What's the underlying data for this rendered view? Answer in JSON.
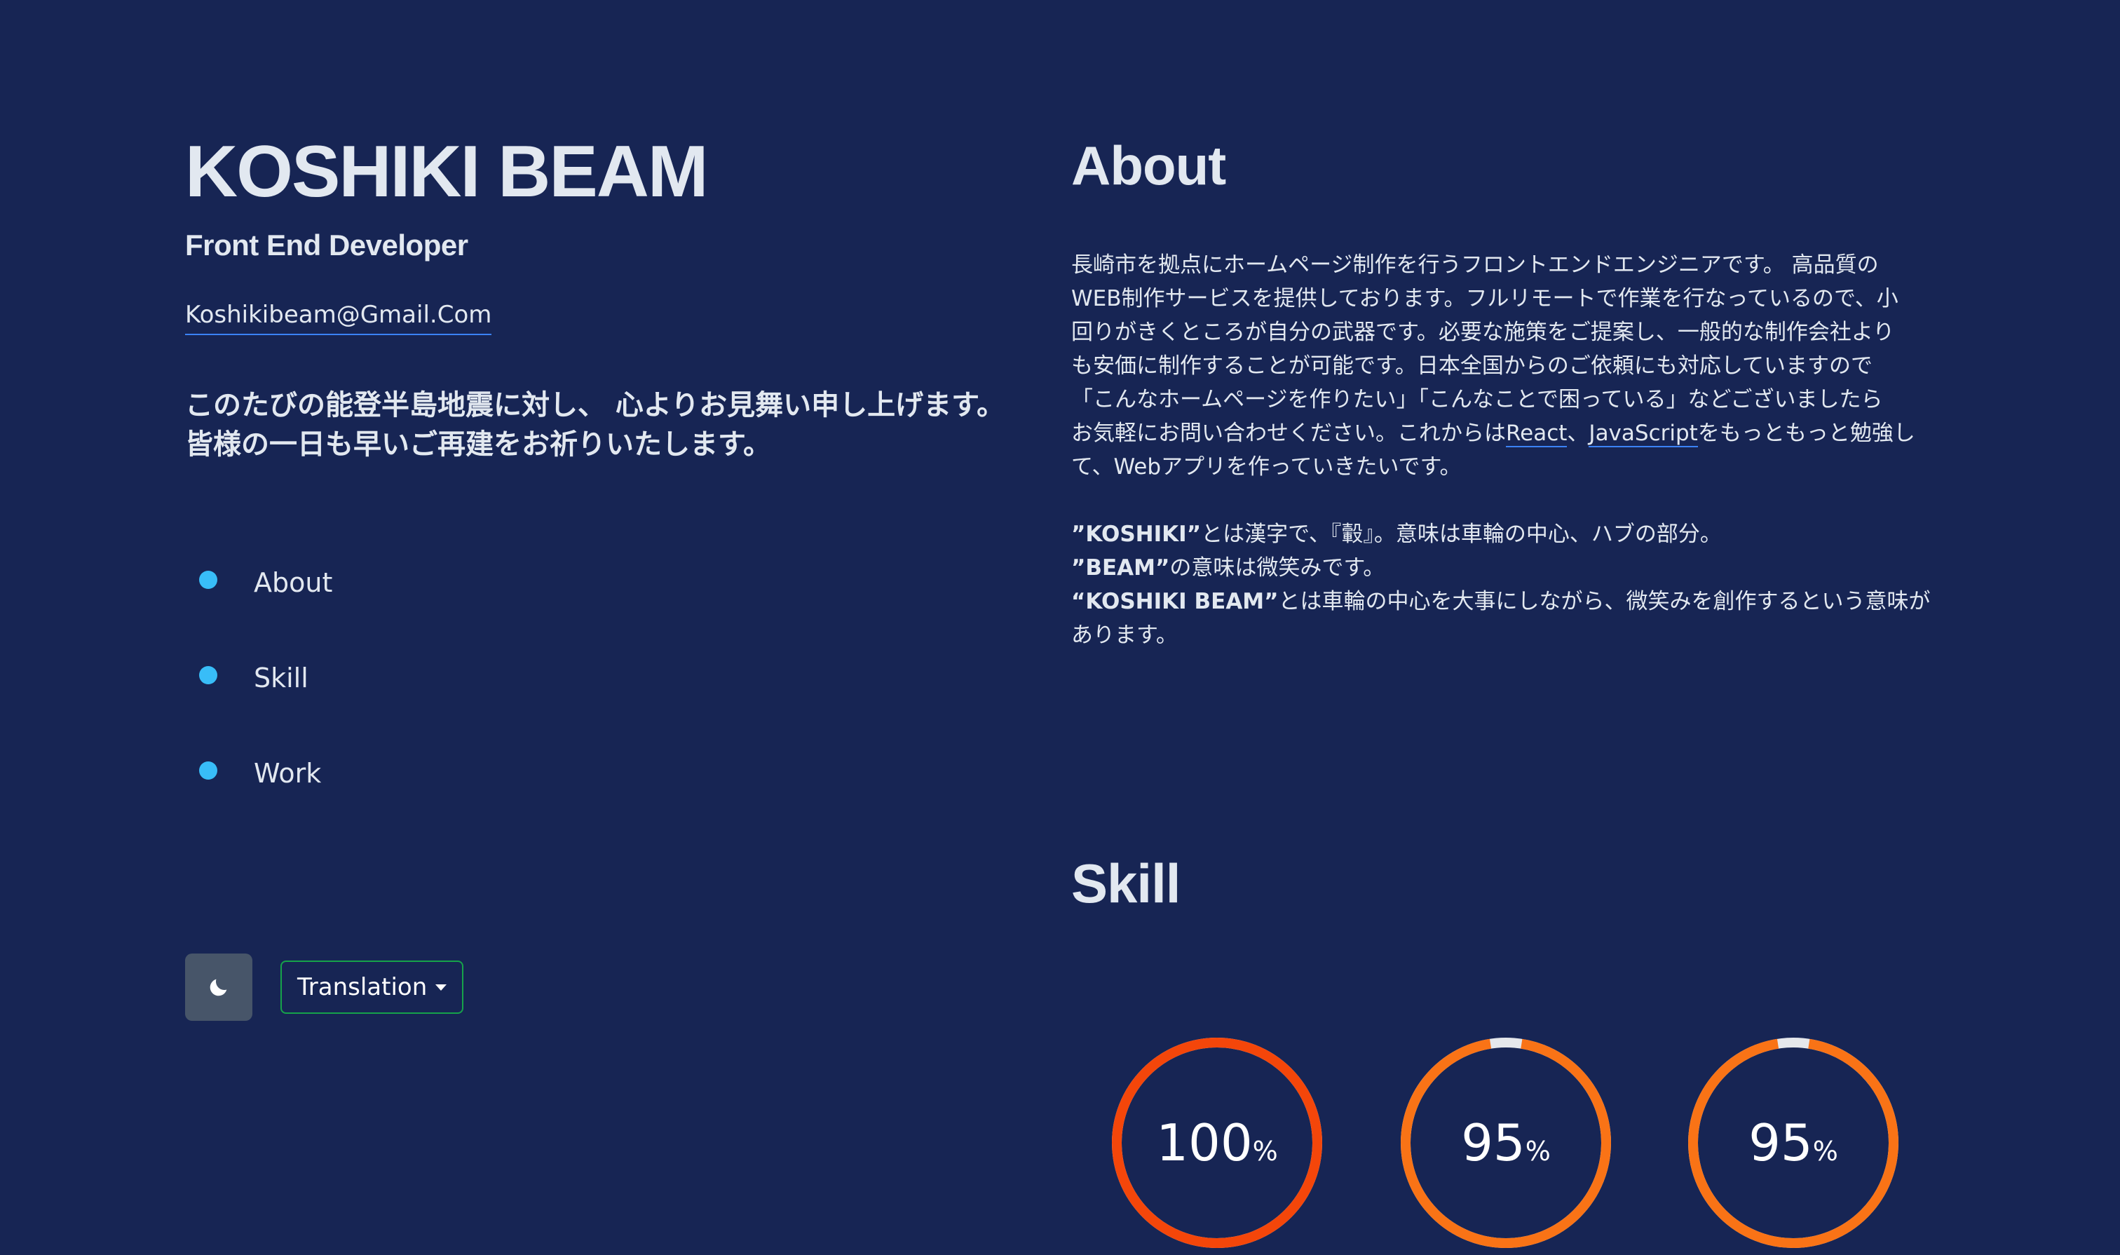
{
  "profile": {
    "name": "KOSHIKI BEAM",
    "role": "Front End Developer",
    "email": "Koshikibeam@Gmail.Com",
    "message_lines": [
      "このたびの能登半島地震に対し、 心よりお見舞い申し上げます。",
      "皆様の一日も早いご再建をお祈りいたします。"
    ]
  },
  "nav": {
    "items": [
      {
        "label": "About",
        "icon": "dot-icon"
      },
      {
        "label": "Skill",
        "icon": "dot-icon"
      },
      {
        "label": "Work",
        "icon": "dot-icon"
      }
    ]
  },
  "controls": {
    "theme_icon": "moon-icon",
    "translation_label": "Translation",
    "translation_icon": "caret-down-icon"
  },
  "about": {
    "title": "About",
    "lines": [
      "長崎市を拠点にホームページ制作を行うフロントエンドエンジニアです。 高品質の",
      "WEB制作サービスを提供しております。フルリモートで作業を行なっているので、小",
      "回りがきくところが自分の武器です。必要な施策をご提案し、一般的な制作会社より",
      "も安価に制作することが可能です。日本全国からのご依頼にも対応していますので",
      "「こんなホームページを作りたい」「こんなことで困っている」などございましたら"
    ],
    "line6_prefix": "お気軽にお問い合わせください。これからは",
    "link_react": "React",
    "sep": "、",
    "link_js": "JavaScript",
    "line6_suffix": "をもっともっと勉強し",
    "line7": "て、Webアプリを作っていきたいです。",
    "meaning": [
      {
        "term": "”KOSHIKI”",
        "text": "とは漢字で、『轂』。意味は車輪の中心、ハブの部分。"
      },
      {
        "term": "”BEAM”",
        "text": "の意味は微笑みです。"
      },
      {
        "term": "“KOSHIKI BEAM”",
        "text": "とは車輪の中心を大事にしながら、微笑みを創作するという意味が"
      }
    ],
    "meaning_last": "あります。"
  },
  "skill": {
    "title": "Skill",
    "charts": [
      {
        "value": 100,
        "unit": "%",
        "color": "#f4460a"
      },
      {
        "value": 95,
        "unit": "%",
        "color": "#f97316"
      },
      {
        "value": 95,
        "unit": "%",
        "color": "#f97316"
      }
    ],
    "track_color": "#e5e7eb"
  },
  "theme": {
    "background": "#172554",
    "text": "#e2e8f0",
    "accent": "#38bdf8",
    "link_underline": "#3b82f6",
    "button_border": "#16a34a"
  }
}
